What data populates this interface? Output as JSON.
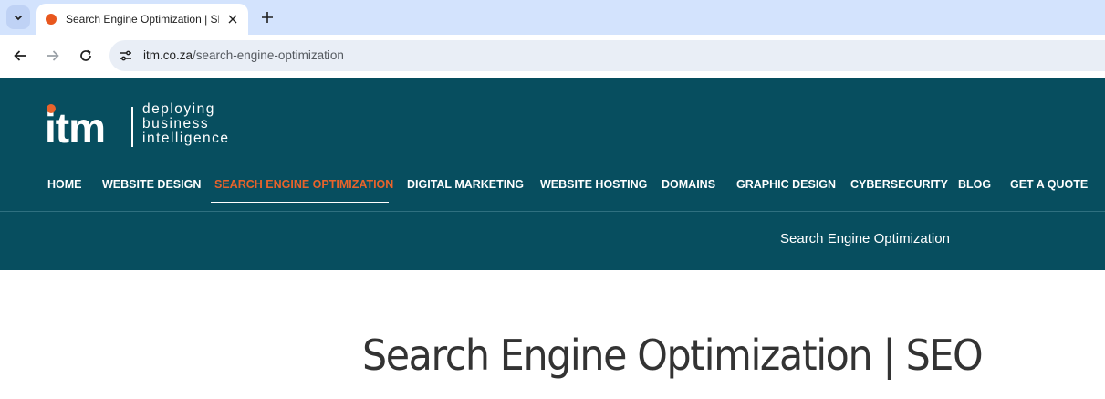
{
  "browser": {
    "tab": {
      "title": "Search Engine Optimization | SEO"
    },
    "address": {
      "host": "itm.co.za",
      "path": "/search-engine-optimization"
    }
  },
  "site": {
    "logo": {
      "wordmark": "itm",
      "tagline": [
        "deploying",
        "business",
        "intelligence"
      ]
    },
    "nav": [
      {
        "label": "HOME",
        "active": false
      },
      {
        "label": "WEBSITE DESIGN",
        "active": false
      },
      {
        "label": "SEARCH ENGINE OPTIMIZATION",
        "active": true
      },
      {
        "label": "DIGITAL MARKETING",
        "active": false
      },
      {
        "label": "WEBSITE HOSTING",
        "active": false
      },
      {
        "label": "DOMAINS",
        "active": false
      },
      {
        "label": "GRAPHIC DESIGN",
        "active": false
      },
      {
        "label": "CYBERSECURITY",
        "active": false
      },
      {
        "label": "BLOG",
        "active": false
      },
      {
        "label": "GET A QUOTE",
        "active": false
      }
    ],
    "breadcrumb": "Search Engine Optimization",
    "page_title": "Search Engine Optimization | SEO"
  },
  "colors": {
    "header_bg": "#074e5f",
    "accent": "#e8632b",
    "tabstrip": "#d3e3fd"
  }
}
